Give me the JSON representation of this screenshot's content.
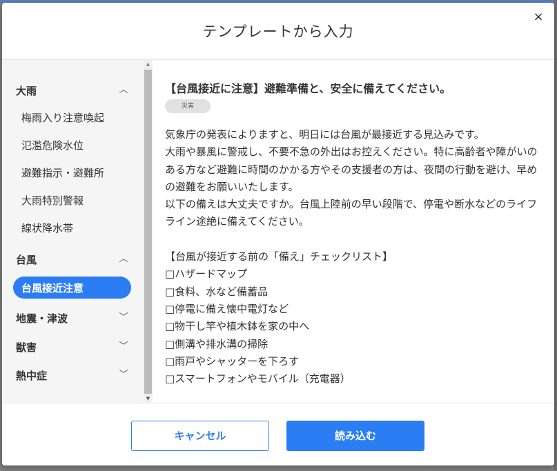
{
  "modal": {
    "title": "テンプレートから入力",
    "close_icon": "×"
  },
  "sidebar": {
    "categories": [
      {
        "label": "大雨",
        "expanded": true,
        "items": [
          "梅雨入り注意喚起",
          "氾濫危険水位",
          "避難指示・避難所",
          "大雨特別警報",
          "線状降水帯"
        ]
      },
      {
        "label": "台風",
        "expanded": true,
        "items": [
          "台風接近注意"
        ],
        "selected": "台風接近注意"
      },
      {
        "label": "地震・津波",
        "expanded": false,
        "items": []
      },
      {
        "label": "獣害",
        "expanded": false,
        "items": []
      },
      {
        "label": "熱中症",
        "expanded": false,
        "items": []
      }
    ],
    "chevron_up": "︿",
    "chevron_down": "﹀"
  },
  "content": {
    "title": "【台風接近に注意】避難準備と、安全に備えてください。",
    "tag": "災害",
    "body": "気象庁の発表によりますと、明日には台風が最接近する見込みです。\n大雨や暴風に警戒し、不要不急の外出はお控えください。特に高齢者や障がいのある方など避難に時間のかかる方やその支援者の方は、夜間の行動を避け、早めの避難をお願いいたします。\n以下の備えは大丈夫ですか。台風上陸前の早い段階で、停電や断水などのライフライン途絶に備えてください。\n\n【台風が接近する前の「備え」チェックリスト】\n□ハザードマップ\n□食料、水など備蓄品\n□停電に備え懐中電灯など\n□物干し竿や植木鉢を家の中へ\n□側溝や排水溝の掃除\n□雨戸やシャッターを下ろす\n□スマートフォンやモバイル（充電器）"
  },
  "footer": {
    "cancel_label": "キャンセル",
    "load_label": "読み込む"
  },
  "colors": {
    "accent": "#2b7df3",
    "sidebar_bg": "#f5f5f5"
  }
}
